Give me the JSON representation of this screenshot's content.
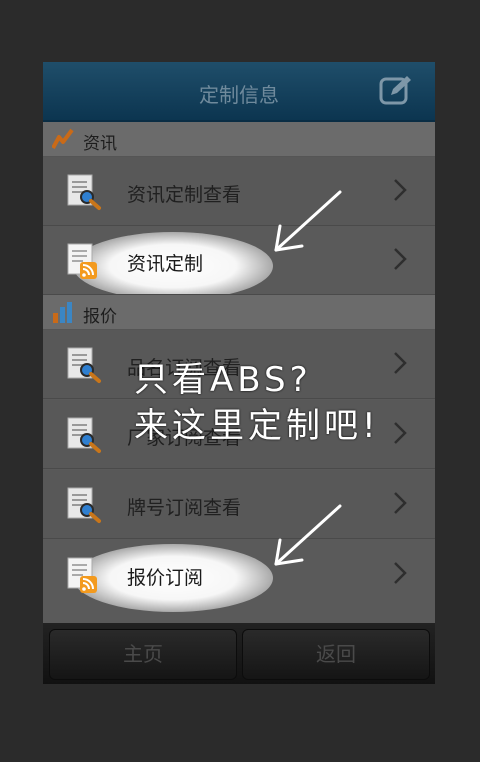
{
  "header": {
    "title": "定制信息",
    "edit_icon": "edit-icon"
  },
  "sections": [
    {
      "label": "资讯",
      "icon": "trend-icon",
      "color": "#c96a18"
    },
    {
      "label": "报价",
      "icon": "bar-chart-icon",
      "color": "#3b86c4"
    }
  ],
  "rows": [
    {
      "label": "资讯定制查看",
      "icon": "doc-search-icon"
    },
    {
      "label": "资讯定制",
      "icon": "doc-rss-icon"
    },
    {
      "label": "品名订阅查看",
      "icon": "doc-search-icon"
    },
    {
      "label": "厂家订阅查看",
      "icon": "doc-search-icon"
    },
    {
      "label": "牌号订阅查看",
      "icon": "doc-search-icon"
    },
    {
      "label": "报价订阅",
      "icon": "doc-rss-icon"
    }
  ],
  "footer": {
    "home_label": "主页",
    "back_label": "返回"
  },
  "overlay": {
    "line1": "只看ABS?",
    "line2": "来这里定制吧!"
  }
}
